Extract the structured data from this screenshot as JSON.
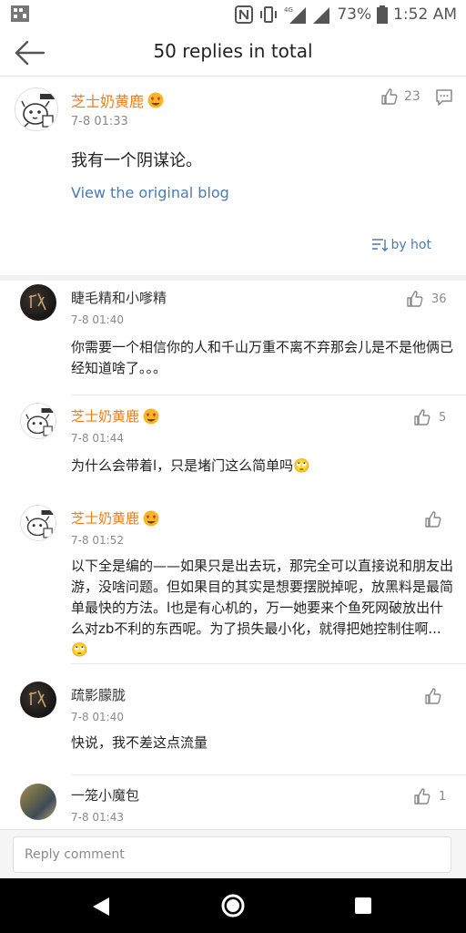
{
  "status": {
    "battery_pct": "73%",
    "time": "1:52 AM",
    "network": "4G"
  },
  "header": {
    "title": "50 replies in total"
  },
  "main_post": {
    "author": "芝士奶黄鹿",
    "time": "7-8 01:33",
    "likes": "23",
    "text": "我有一个阴谋论。",
    "link": "View the original blog",
    "sort_label": "by hot"
  },
  "comments": [
    {
      "author": "睫毛精和小嗲精",
      "time": "7-8 01:40",
      "likes": "36",
      "text": "你需要一个相信你的人和千山万重不离不弃那会儿是不是他俩已经知道啥了。。。"
    },
    {
      "author": "芝士奶黄鹿",
      "time": "7-8 01:44",
      "likes": "5",
      "text": "为什么会带着l，只是堵门这么简单吗🙄"
    },
    {
      "author": "芝士奶黄鹿",
      "time": "7-8 01:52",
      "likes": "",
      "text": "以下全是编的——如果只是出去玩，那完全可以直接说和朋友出游，没啥问题。但如果目的其实是想要摆脱掉呢，放黑料是最简单最快的方法。l也是有心机的，万一她要来个鱼死网破放出什么对zb不利的东西呢。为了损失最小化，就得把她控制住啊...🙄"
    },
    {
      "author": "疏影朦胧",
      "time": "7-8 01:40",
      "likes": "",
      "text": "快说，我不差这点流量"
    },
    {
      "author": "一笼小魔包",
      "time": "7-8 01:43",
      "likes": "1",
      "text": ""
    }
  ],
  "reply_bar": {
    "placeholder": "Reply comment"
  },
  "colors": {
    "accent_orange": "#ef7c1a",
    "link_blue": "#4a7ab0",
    "muted": "#8a8a8a"
  }
}
